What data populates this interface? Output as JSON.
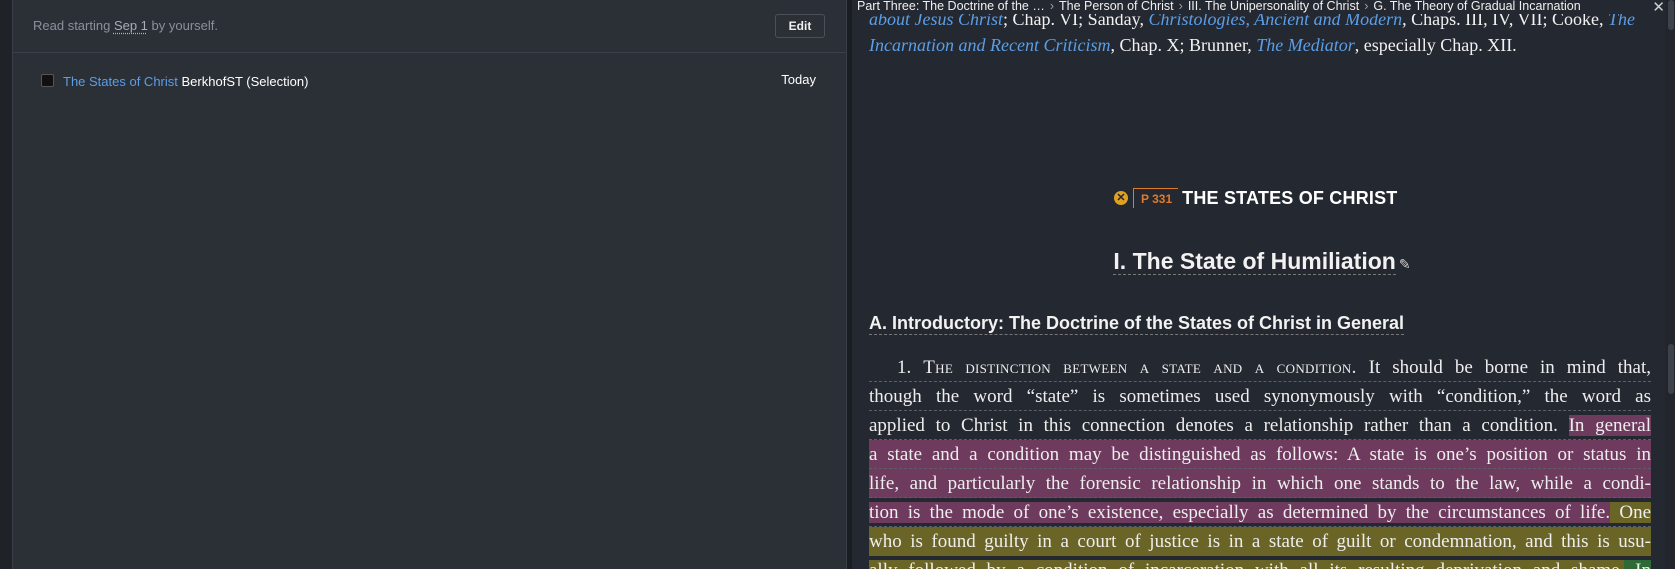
{
  "plan": {
    "description_prefix": "Read starting ",
    "description_date": "Sep 1",
    "description_suffix": " by yourself.",
    "edit_label": "Edit",
    "row": {
      "link": "The States of Christ",
      "source": "BerkhofST (Selection)",
      "date": "Today"
    }
  },
  "breadcrumb": [
    "Part Three: The Doctrine of the …",
    "The Person of Christ",
    "III. The Unipersonality of Christ",
    "G. The Theory of Gradual Incarnation"
  ],
  "document": {
    "top_line1_a": "about Jesus Christ",
    "top_line1_b": "; Chap. VI; Sanday, ",
    "top_line1_c": "Christologies, Ancient and Modern",
    "top_line1_d": ", Chaps. III, IV, VII; Cooke, ",
    "top_line1_e": "The",
    "top_line2_a": "Incarnation and Recent Criticism",
    "top_line2_b": ", Chap. X; Brunner, ",
    "top_line2_c": "The Mediator",
    "top_line2_d": ", especially Chap. XII.",
    "page_marker": "P 331",
    "states_title": "THE STATES OF CHRIST",
    "humiliation_title": "I. The State of Humiliation",
    "intro_heading": "A. Introductory: The Doctrine of the States of Christ in General",
    "p1_num": "1. ",
    "p1_caps": "The distinction between a state and a condition.",
    "p1_l1": " It should be borne in mind that,",
    "p1_l2": "though the word “state” is sometimes used synonymously with “condition,” the word as",
    "p1_l3a": "applied to Christ in this connection denotes a relationship rather than a condition. ",
    "p1_l3b": "In general",
    "p1_l4": "a state and a condition may be distinguished as follows: A state is one’s position or status in",
    "p1_l5": "life, and particularly the forensic relationship in which one stands to the law, while a condi-",
    "p1_l6a": "tion is the mode of one’s existence, especially as determined by the circumstances of life.",
    "p1_l6b": " One",
    "p1_l7": "who is found guilty in a court of justice is in a state of guilt or condemnation, and this is usu-",
    "p1_l8a": "ally followed by a condition of incarceration with all its resulting deprivation and shame.",
    "p1_l8b": " In"
  },
  "colors": {
    "link": "#5b9ee8",
    "highlight_pink": "#6e3a5e",
    "highlight_olive": "#6a6526",
    "highlight_green": "#2f6a36",
    "page_marker": "#e07a2a"
  }
}
